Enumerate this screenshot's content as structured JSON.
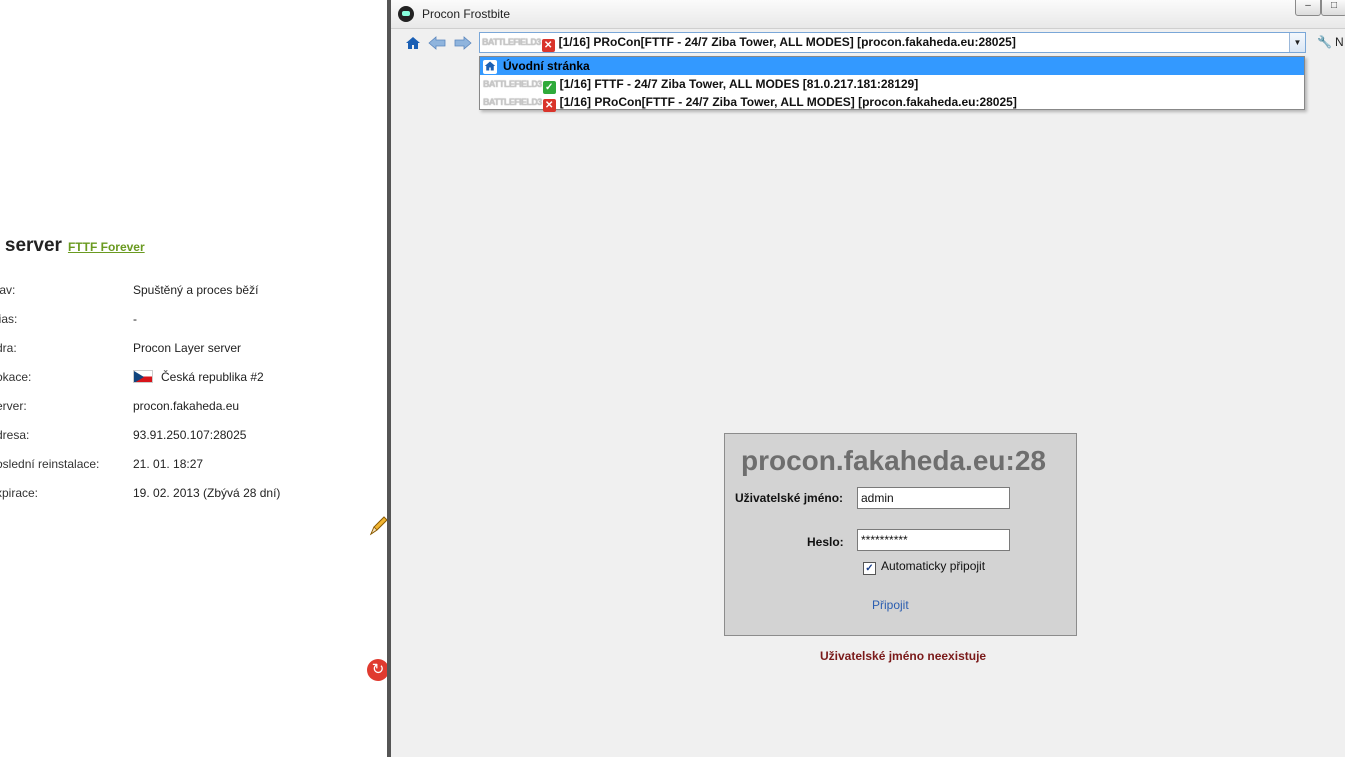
{
  "background_page": {
    "title": "o server",
    "title_link": "FTTF Forever",
    "rows": [
      {
        "label": "tav:",
        "value": "Spuštěný a proces běží"
      },
      {
        "label": "lias:",
        "value": "-"
      },
      {
        "label": "dra:",
        "value": "Procon Layer server"
      },
      {
        "label": "okace:",
        "value": "Česká republika #2"
      },
      {
        "label": "erver:",
        "value": "procon.fakaheda.eu"
      },
      {
        "label": "dresa:",
        "value": "93.91.250.107:28025"
      },
      {
        "label": "oslední reinstalace:",
        "value": "21. 01. 18:27"
      },
      {
        "label": "xpirace:",
        "value": "19. 02. 2013 (Zbývá 28 dní)"
      }
    ]
  },
  "window": {
    "title": "Procon Frostbite",
    "controls": {
      "minimize": "–",
      "maximize": "□"
    }
  },
  "toolbar": {
    "home_icon": "house-icon",
    "back_icon": "arrow-left-icon",
    "forward_icon": "arrow-right-icon",
    "tools_label": "N",
    "selected_server": {
      "game_logo": "BATTLEFIELD3",
      "status": "error",
      "label": "[1/16] PRoCon[FTTF - 24/7 Ziba Tower, ALL MODES] [procon.fakaheda.eu:28025]"
    }
  },
  "dropdown": {
    "items": [
      {
        "label": "Úvodní stránka",
        "type": "home",
        "selected": true
      },
      {
        "game_logo": "BATTLEFIELD3",
        "status": "ok",
        "label": "[1/16] FTTF - 24/7 Ziba Tower, ALL MODES [81.0.217.181:28129]"
      },
      {
        "game_logo": "BATTLEFIELD3",
        "status": "error",
        "label": "[1/16] PRoCon[FTTF - 24/7 Ziba Tower, ALL MODES] [procon.fakaheda.eu:28025]"
      }
    ]
  },
  "login": {
    "host": "procon.fakaheda.eu:28",
    "username_label": "Uživatelské jméno:",
    "username_value": "admin",
    "password_label": "Heslo:",
    "password_value": "**********",
    "autoconnect_label": "Automaticky připojit",
    "autoconnect_checked": true,
    "connect_label": "Připojit",
    "error_message": "Uživatelské jméno neexistuje"
  },
  "colors": {
    "accent": "#3399ff",
    "error": "#7a1a1a",
    "link": "#2a5db0",
    "panel": "#d3d3d3"
  }
}
